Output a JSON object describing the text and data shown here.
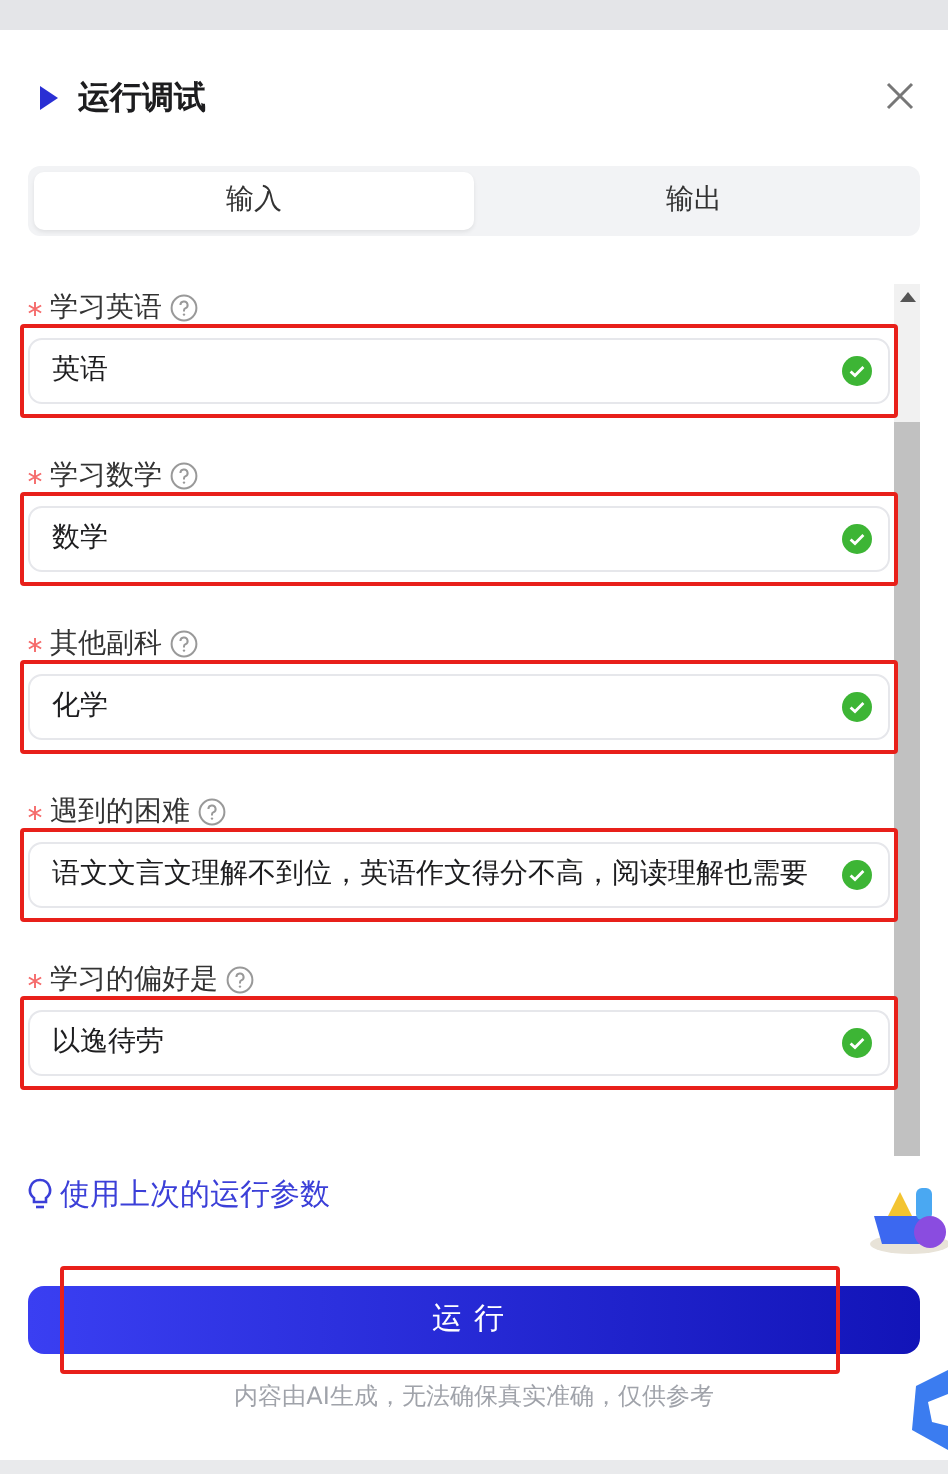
{
  "dialog": {
    "title": "运行调试"
  },
  "tabs": [
    {
      "label": "输入",
      "selected": true
    },
    {
      "label": "输出",
      "selected": false
    }
  ],
  "fields": [
    {
      "label": "学习英语",
      "required": true,
      "value": "英语",
      "valid": true,
      "highlighted": true
    },
    {
      "label": "学习数学",
      "required": true,
      "value": "数学",
      "valid": true,
      "highlighted": true
    },
    {
      "label": "其他副科",
      "required": true,
      "value": "化学",
      "valid": true,
      "highlighted": true
    },
    {
      "label": "遇到的困难",
      "required": true,
      "value": "语文文言文理解不到位，英语作文得分不高，阅读理解也需要",
      "valid": true,
      "highlighted": true
    },
    {
      "label": "学习的偏好是",
      "required": true,
      "value": "以逸待劳",
      "valid": true,
      "highlighted": true
    }
  ],
  "reuse_link": "使用上次的运行参数",
  "run_button": {
    "label": "运行",
    "highlighted": true
  },
  "disclaimer": "内容由AI生成，无法确保真实准确，仅供参考"
}
